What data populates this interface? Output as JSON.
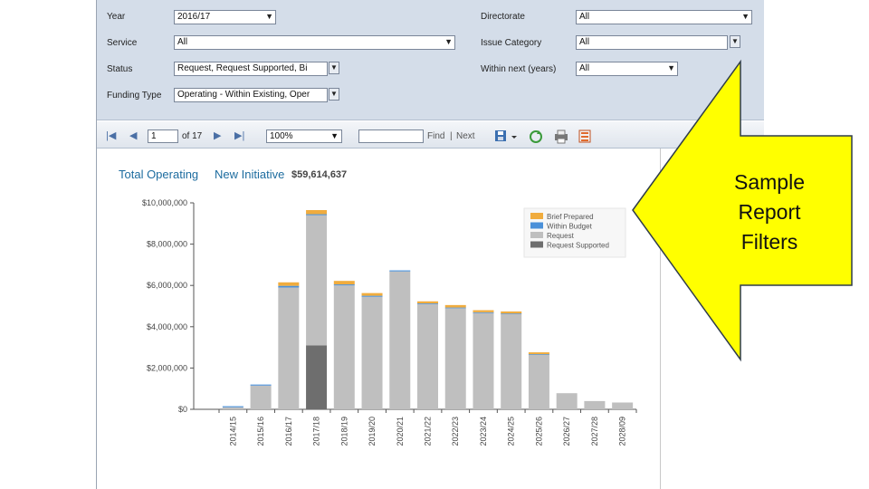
{
  "filters": {
    "year": {
      "label": "Year",
      "value": "2016/17"
    },
    "service": {
      "label": "Service",
      "value": "All"
    },
    "status": {
      "label": "Status",
      "value": "Request, Request Supported, Bi"
    },
    "funding_type": {
      "label": "Funding Type",
      "value": "Operating - Within Existing, Oper"
    },
    "directorate": {
      "label": "Directorate",
      "value": "All"
    },
    "issue_category": {
      "label": "Issue Category",
      "value": "All"
    },
    "within_next": {
      "label": "Within next (years)",
      "value": "All"
    }
  },
  "toolbar": {
    "page": "1",
    "of_label": "of 17",
    "zoom": "100%",
    "find_label": "Find",
    "next_label": "Next",
    "separator": "|"
  },
  "report": {
    "link_total": "Total Operating",
    "link_new": "New Initiative",
    "total_amount": "$59,614,637"
  },
  "callout": {
    "line1": "Sample",
    "line2": "Report",
    "line3": "Filters",
    "color": "#ffff00"
  },
  "colors": {
    "brief": "#f0ac3e",
    "within": "#4a90d9",
    "request": "#bfbfbf",
    "supported": "#6e6e6e"
  },
  "chart_data": {
    "type": "bar",
    "stacked": true,
    "categories": [
      "2014/15",
      "2015/16",
      "2016/17",
      "2017/18",
      "2018/19",
      "2019/20",
      "2020/21",
      "2021/22",
      "2022/23",
      "2023/24",
      "2024/25",
      "2025/26",
      "2026/27",
      "2027/28",
      "2028/09"
    ],
    "series": [
      {
        "name": "Request Supported",
        "values": [
          0,
          0,
          0,
          3100000,
          0,
          0,
          0,
          0,
          0,
          0,
          0,
          0,
          0,
          0,
          0
        ]
      },
      {
        "name": "Request",
        "values": [
          100000,
          1150000,
          5900000,
          6300000,
          6000000,
          5450000,
          6680000,
          5100000,
          4900000,
          4680000,
          4620000,
          2650000,
          780000,
          400000,
          330000
        ]
      },
      {
        "name": "Within Budget",
        "values": [
          50000,
          50000,
          80000,
          50000,
          50000,
          50000,
          50000,
          30000,
          30000,
          20000,
          20000,
          20000,
          0,
          0,
          0
        ]
      },
      {
        "name": "Brief Prepared",
        "values": [
          0,
          0,
          170000,
          200000,
          170000,
          130000,
          0,
          100000,
          120000,
          100000,
          100000,
          90000,
          0,
          0,
          0
        ]
      }
    ],
    "yticks": [
      "$10,000,000",
      "$8,000,000",
      "$6,000,000",
      "$4,000,000",
      "$2,000,000",
      "$0"
    ],
    "ylim": [
      0,
      10000000
    ],
    "legend_position": "top-right",
    "grid": false
  }
}
